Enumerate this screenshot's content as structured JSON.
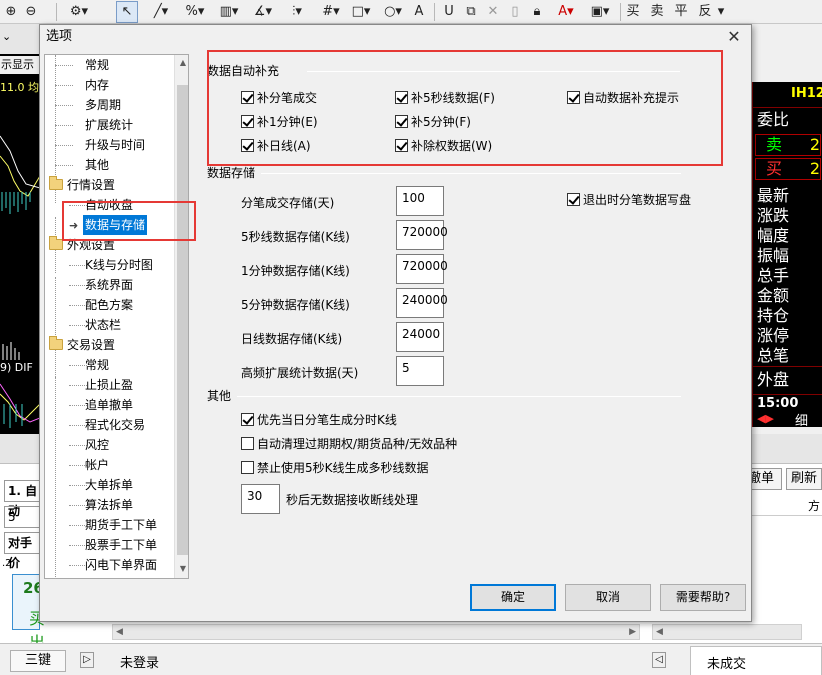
{
  "toolbar": {
    "right_labels": [
      "买",
      "卖",
      "平",
      "反"
    ]
  },
  "background": {
    "left_snippets": [
      "示显示",
      "11.0 均",
      "9) DIF"
    ],
    "right_header": "IH12",
    "right_labels": [
      "委比",
      "卖",
      "买",
      "最新",
      "涨跌",
      "幅度",
      "振幅",
      "总手",
      "金额",
      "持仓",
      "涨停",
      "总笔",
      "外盘"
    ],
    "right_time": "15:00",
    "right_detail": "细",
    "bottom_left": [
      "1. 自动",
      "5",
      "对手价",
      ".2",
      "26",
      "买出"
    ],
    "bottom_buttons": [
      "撤单",
      "刷新"
    ],
    "bottom_col": "方",
    "status": {
      "keys_label": "三键",
      "login_status": "未登录",
      "tab_label": "未成交"
    }
  },
  "dialog": {
    "title": "选项",
    "close": "✕",
    "tree": [
      {
        "label": "常规",
        "level": 2
      },
      {
        "label": "内存",
        "level": 2
      },
      {
        "label": "多周期",
        "level": 2
      },
      {
        "label": "扩展统计",
        "level": 2
      },
      {
        "label": "升级与时间",
        "level": 2
      },
      {
        "label": "其他",
        "level": 2
      },
      {
        "label": "行情设置",
        "level": 1
      },
      {
        "label": "自动收盘",
        "level": 2
      },
      {
        "label": "数据与存储",
        "level": 2,
        "selected": true
      },
      {
        "label": "外观设置",
        "level": 1
      },
      {
        "label": "K线与分时图",
        "level": 2
      },
      {
        "label": "系统界面",
        "level": 2
      },
      {
        "label": "配色方案",
        "level": 2
      },
      {
        "label": "状态栏",
        "level": 2
      },
      {
        "label": "交易设置",
        "level": 1
      },
      {
        "label": "常规",
        "level": 2
      },
      {
        "label": "止损止盈",
        "level": 2
      },
      {
        "label": "追单撤单",
        "level": 2
      },
      {
        "label": "程式化交易",
        "level": 2
      },
      {
        "label": "风控",
        "level": 2
      },
      {
        "label": "帐户",
        "level": 2
      },
      {
        "label": "大单拆单",
        "level": 2
      },
      {
        "label": "算法拆单",
        "level": 2
      },
      {
        "label": "期货手工下单",
        "level": 2
      },
      {
        "label": "股票手工下单",
        "level": 2
      },
      {
        "label": "闪电下单界面",
        "level": 2
      }
    ],
    "auto_fill": {
      "title": "数据自动补充",
      "options": [
        {
          "label": "补分笔成交",
          "checked": true
        },
        {
          "label": "补5秒线数据(F)",
          "checked": true
        },
        {
          "label": "自动数据补充提示",
          "checked": true
        },
        {
          "label": "补1分钟(E)",
          "checked": true
        },
        {
          "label": "补5分钟(F)",
          "checked": true
        },
        {
          "label": "补日线(A)",
          "checked": true
        },
        {
          "label": "补除权数据(W)",
          "checked": true
        }
      ]
    },
    "storage": {
      "title": "数据存储",
      "fields": [
        {
          "label": "分笔成交存储(天)",
          "value": "100"
        },
        {
          "label": "5秒线数据存储(K线)",
          "value": "720000"
        },
        {
          "label": "1分钟数据存储(K线)",
          "value": "720000"
        },
        {
          "label": "5分钟数据存储(K线)",
          "value": "240000"
        },
        {
          "label": "日线数据存储(K线)",
          "value": "24000"
        },
        {
          "label": "高频扩展统计数据(天)",
          "value": "5"
        }
      ],
      "exit_write": {
        "label": "退出时分笔数据写盘",
        "checked": true
      }
    },
    "other": {
      "title": "其他",
      "options": [
        {
          "label": "优先当日分笔生成分时K线",
          "checked": true
        },
        {
          "label": "自动清理过期期权/期货品种/无效品种",
          "checked": false
        },
        {
          "label": "禁止使用5秒K线生成多秒线数据",
          "checked": false
        }
      ],
      "timeout": {
        "value": "30",
        "label": "秒后无数据接收断线处理"
      }
    },
    "buttons": {
      "ok": "确定",
      "cancel": "取消",
      "help": "需要帮助?"
    }
  }
}
